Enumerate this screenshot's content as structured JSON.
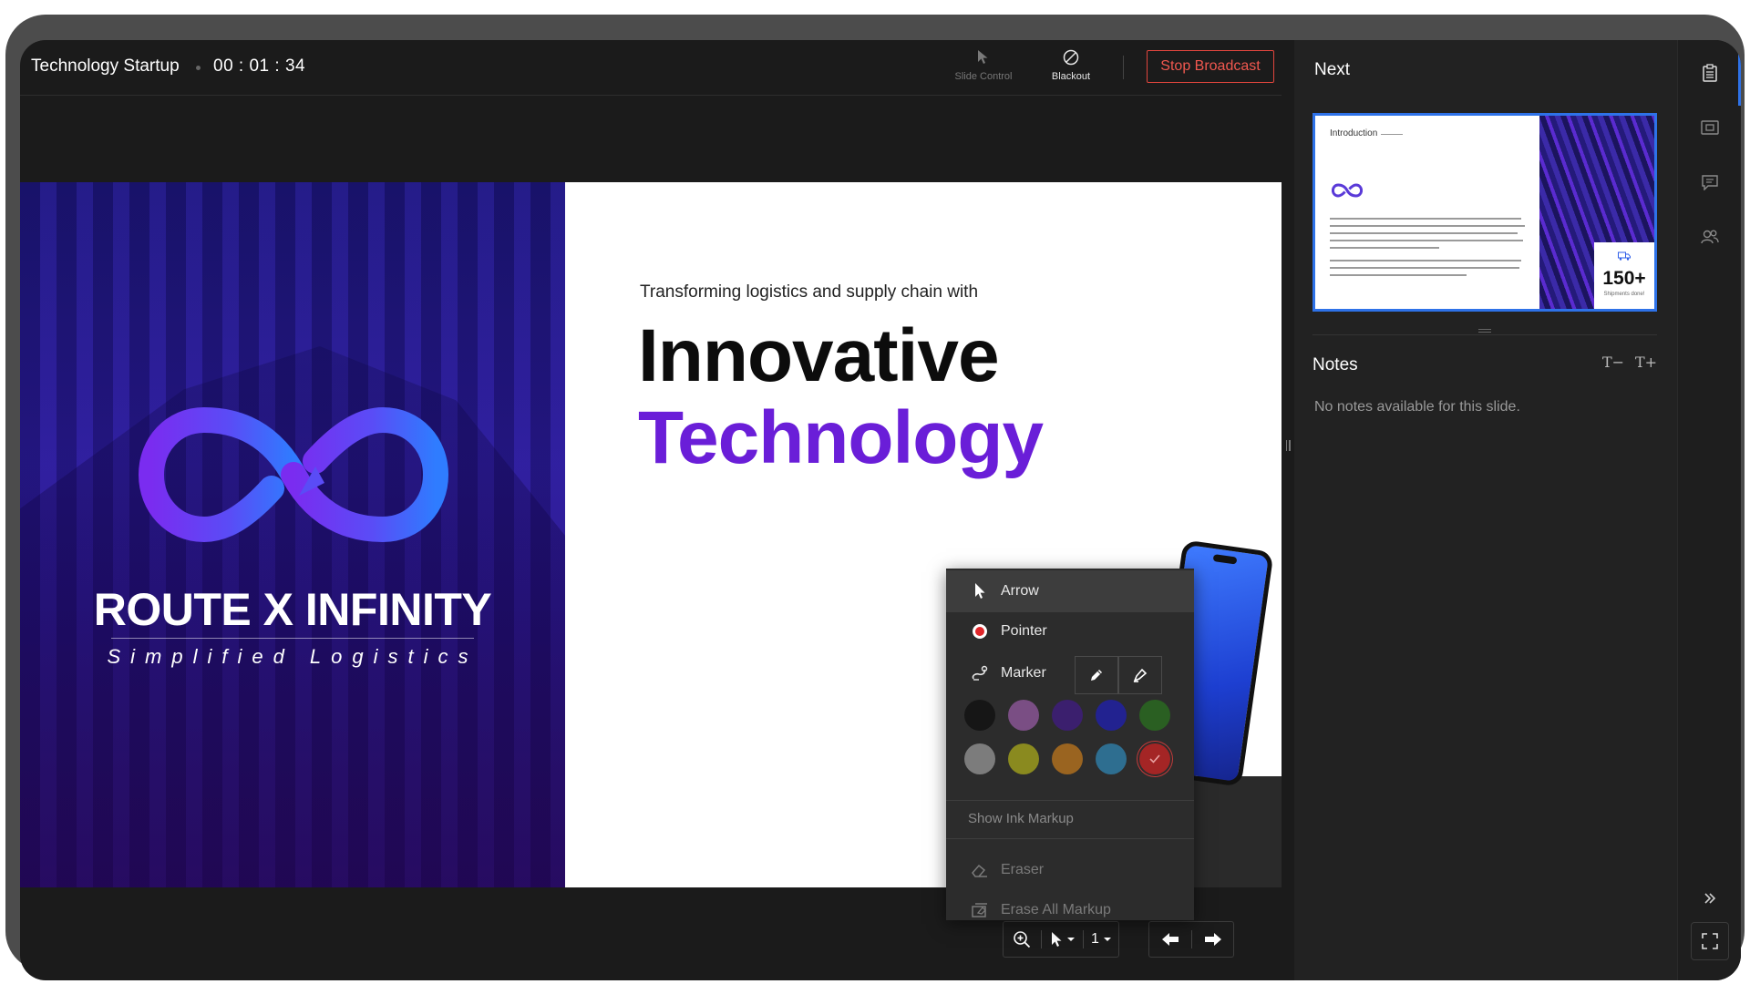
{
  "header": {
    "title": "Technology Startup",
    "timer": "00 : 01 : 34",
    "slide_control_label": "Slide Control",
    "blackout_label": "Blackout",
    "stop_broadcast_label": "Stop Broadcast"
  },
  "slide": {
    "brand_name": "ROUTE X INFINITY",
    "brand_tagline": "Simplified Logistics",
    "subheading": "Transforming logistics and supply chain with",
    "heading_line1": "Innovative",
    "heading_line2": "Technology",
    "heading_accent_color": "#6a1ed8"
  },
  "pointer_menu": {
    "arrow_label": "Arrow",
    "pointer_label": "Pointer",
    "marker_label": "Marker",
    "marker_tools": [
      "pen-icon",
      "highlighter-icon"
    ],
    "colors": [
      "#161616",
      "#7a4e84",
      "#3b1f6e",
      "#222290",
      "#2a5f22",
      "#7c7c7c",
      "#8a8a1f",
      "#9a6420",
      "#2e6e90",
      "#a42525"
    ],
    "selected_color_index": 9,
    "show_ink_markup_label": "Show Ink Markup",
    "eraser_label": "Eraser",
    "erase_all_label": "Erase All Markup"
  },
  "controls": {
    "page_number": "1"
  },
  "panel": {
    "next_label": "Next",
    "thumbnail": {
      "intro_label": "Introduction",
      "stat_value": "150+",
      "stat_caption": "Shipments done!"
    },
    "notes_label": "Notes",
    "font_decrease": "T−",
    "font_increase": "T+",
    "notes_empty": "No notes available for this slide."
  },
  "rail": {
    "icons": [
      "slides-icon",
      "presenter-view-icon",
      "comments-icon",
      "audience-icon",
      "collapse-icon",
      "fullscreen-icon"
    ]
  }
}
